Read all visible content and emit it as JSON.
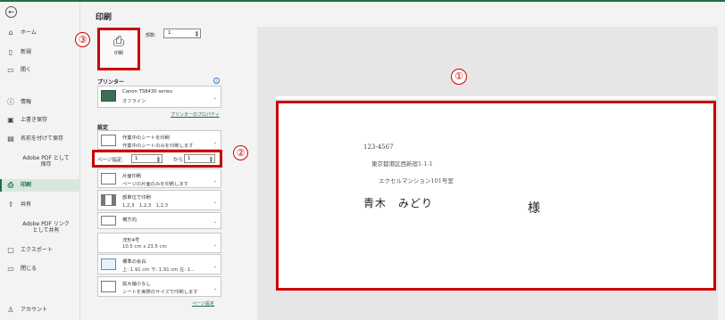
{
  "nav": {
    "back_glyph": "←",
    "items": [
      {
        "key": "home",
        "icon": "⌂",
        "label": "ホーム"
      },
      {
        "key": "new",
        "icon": "▯",
        "label": "新規"
      },
      {
        "key": "open",
        "icon": "▭",
        "label": "開く"
      },
      {
        "key": "info",
        "icon": "ⓘ",
        "label": "情報"
      },
      {
        "key": "save",
        "icon": "▣",
        "label": "上書き保存"
      },
      {
        "key": "saveas",
        "icon": "▤",
        "label": "名前を付けて保存"
      },
      {
        "key": "adobe-pdf-save",
        "icon": "",
        "label": "Adobe PDF として保存"
      },
      {
        "key": "print",
        "icon": "⎙",
        "label": "印刷"
      },
      {
        "key": "share",
        "icon": "⇪",
        "label": "共有"
      },
      {
        "key": "adobe-pdf-link",
        "icon": "",
        "label": "Adobe PDF リンクとして共有"
      },
      {
        "key": "export",
        "icon": "▢",
        "label": "エクスポート"
      },
      {
        "key": "close",
        "icon": "▭",
        "label": "閉じる"
      },
      {
        "key": "account",
        "icon": "♙",
        "label": "アカウント"
      }
    ],
    "active": "print"
  },
  "page_title": "印刷",
  "print_button": {
    "label": "印刷",
    "icon": "printer-icon"
  },
  "copies": {
    "label": "部数:",
    "value": "1"
  },
  "printer": {
    "section_title": "プリンター",
    "name": "Canon TS8430 series",
    "status": "オフライン",
    "properties_link": "プリンターのプロパティ"
  },
  "settings": {
    "section_title": "設定",
    "scope": {
      "line1": "作業中のシートを印刷",
      "line2": "作業中のシートのみを印刷します"
    },
    "pages": {
      "label": "ページ指定:",
      "from": "1",
      "to_label": "から",
      "to": "1"
    },
    "sides": {
      "line1": "片面印刷",
      "line2": "ページの片面のみを印刷します"
    },
    "collate": {
      "line1": "部単位で印刷",
      "line2": "1,2,3　1,2,3　1,2,3"
    },
    "orientation": {
      "line1": "横方向"
    },
    "paper": {
      "line1": "洋形4号",
      "line2": "10.5 cm x 23.5 cm"
    },
    "margins": {
      "line1": "標準の余白",
      "line2": "上: 1.91 cm 下: 1.91 cm 左: 1..."
    },
    "scaling": {
      "line1": "拡大縮小なし",
      "line2": "シートを実際のサイズで印刷します"
    },
    "page_setup_link": "ページ設定"
  },
  "callouts": {
    "preview": "①",
    "pages": "②",
    "print": "③"
  },
  "preview": {
    "postal_code": "123-4567",
    "address1": "東京都港区西新宿1-1-1",
    "address2": "エクセルマンション101号室",
    "recipient": "青木　みどり",
    "honorific": "様"
  }
}
